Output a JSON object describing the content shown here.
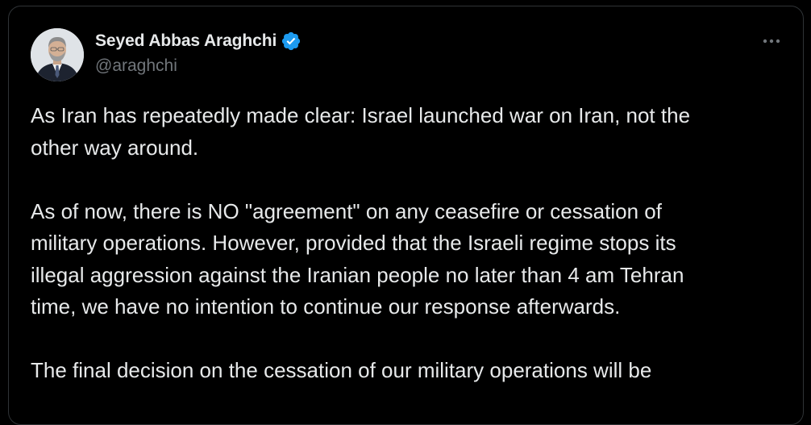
{
  "author": {
    "display_name": "Seyed Abbas Araghchi",
    "handle": "@araghchi",
    "verified": true,
    "verified_icon": "verified-badge-icon",
    "verified_color": "#1d9bf0"
  },
  "menu": {
    "icon": "more-horizontal-icon"
  },
  "tweet": {
    "paragraphs": [
      "As Iran has repeatedly made clear: Israel launched war on Iran, not the\nother way around.",
      "As of now, there is NO \"agreement\" on any ceasefire or cessation of\nmilitary operations. However, provided that the Israeli regime stops its\nillegal aggression against the Iranian people no later than 4 am Tehran\ntime, we have no intention to continue our response afterwards.",
      "The final decision on the cessation of our military operations will be"
    ]
  },
  "colors": {
    "background": "#000000",
    "text_primary": "#e7e9ea",
    "text_secondary": "#71767b",
    "border": "#2f3336"
  }
}
